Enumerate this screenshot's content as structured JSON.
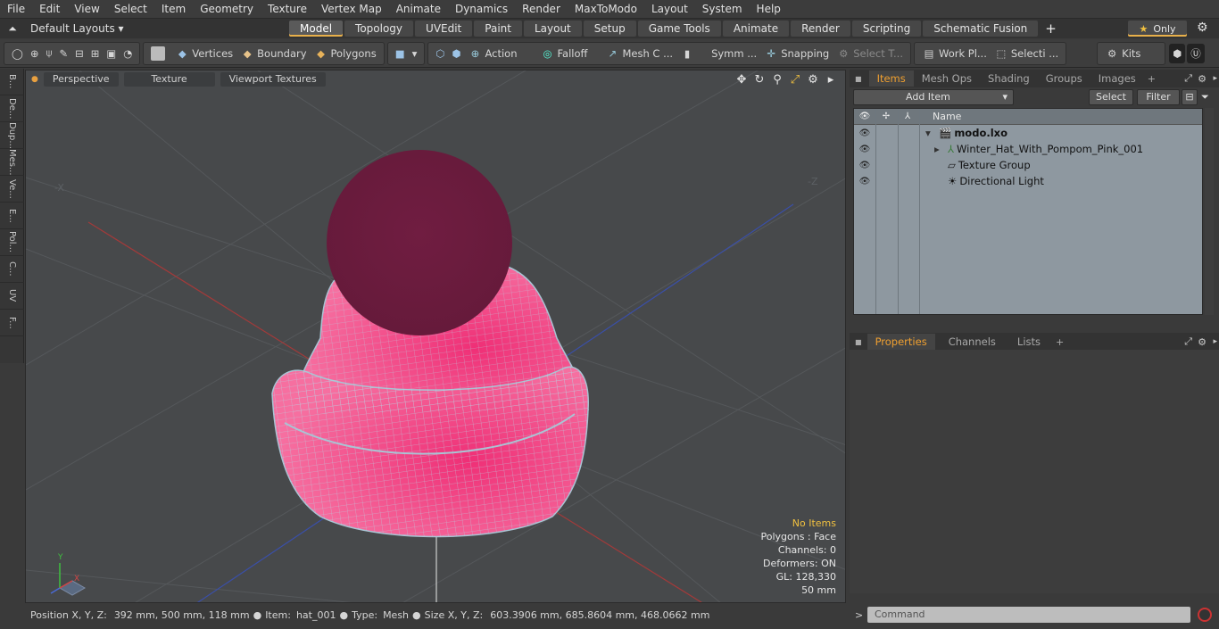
{
  "menubar": [
    "File",
    "Edit",
    "View",
    "Select",
    "Item",
    "Geometry",
    "Texture",
    "Vertex Map",
    "Animate",
    "Dynamics",
    "Render",
    "MaxToModo",
    "Layout",
    "System",
    "Help"
  ],
  "layouts": {
    "label": "Default Layouts ▾"
  },
  "mode_tabs": [
    "Model",
    "Topology",
    "UVEdit",
    "Paint",
    "Layout",
    "Setup",
    "Game Tools",
    "Animate",
    "Render",
    "Scripting",
    "Schematic Fusion"
  ],
  "only_label": "Only",
  "toolbar": {
    "vertices": "Vertices",
    "boundary": "Boundary",
    "polygons": "Polygons",
    "action": "Action",
    "falloff": "Falloff",
    "mesh_c": "Mesh C ...",
    "symm": "Symm ...",
    "snapping": "Snapping",
    "select_t": "Select T...",
    "work_pl": "Work Pl...",
    "selecti": "Selecti ...",
    "kits": "Kits"
  },
  "left_strip": [
    "B...",
    "De...",
    "Dup...",
    "Mes...",
    "Ve...",
    "E...",
    "Pol...",
    "C...",
    "UV",
    "F..."
  ],
  "viewport": {
    "tabs": [
      "Perspective",
      "Texture",
      "Viewport Textures"
    ],
    "stats": {
      "no_items": "No Items",
      "polygons": "Polygons : Face",
      "channels": "Channels: 0",
      "deformers": "Deformers: ON",
      "gl": "GL: 128,330",
      "unit": "50 mm"
    }
  },
  "statusbar": {
    "position_label": "Position X, Y, Z:",
    "position_value": "392 mm, 500 mm, 118 mm",
    "item_label": "Item:",
    "item_value": "hat_001",
    "type_label": "Type:",
    "type_value": "Mesh",
    "size_label": "Size X, Y, Z:",
    "size_value": "603.3906 mm, 685.8604 mm, 468.0662 mm"
  },
  "items_panel": {
    "tabs": [
      "Items",
      "Mesh Ops",
      "Shading",
      "Groups",
      "Images"
    ],
    "add_item": "Add Item",
    "select": "Select",
    "filter": "Filter",
    "name_header": "Name",
    "rows": [
      "modo.lxo",
      "Winter_Hat_With_Pompom_Pink_001",
      "Texture Group",
      "Directional Light"
    ]
  },
  "props_panel": {
    "tabs": [
      "Properties",
      "Channels",
      "Lists"
    ]
  },
  "command": {
    "placeholder": "Command"
  },
  "colors": {
    "hat": "#f0367a",
    "pompom": "#6e1d3f",
    "wire": "#a9c4d4",
    "accent": "#f0a030"
  }
}
